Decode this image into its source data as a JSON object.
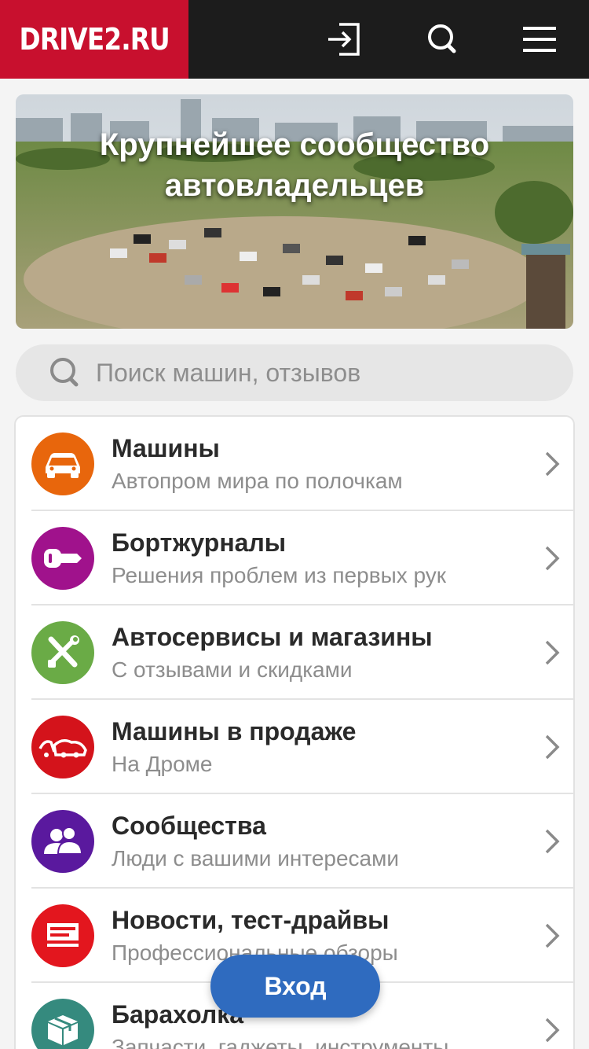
{
  "header": {
    "logo_text": "DRIVE2.RU",
    "icons": [
      "login-icon",
      "search-icon",
      "menu-icon"
    ],
    "colors": {
      "logo_bg": "#c8102e",
      "bar_bg": "#1c1c1c"
    }
  },
  "hero": {
    "title": "Крупнейшее сообщество автовладельцев"
  },
  "search": {
    "placeholder": "Поиск машин, отзывов"
  },
  "menu": {
    "items": [
      {
        "title": "Машины",
        "subtitle": "Автопром мира по полочкам",
        "icon": "car-icon",
        "color": "#e8660c"
      },
      {
        "title": "Бортжурналы",
        "subtitle": "Решения проблем из первых рук",
        "icon": "key-icon",
        "color": "#a0128c"
      },
      {
        "title": "Автосервисы и магазины",
        "subtitle": "С отзывами и скидками",
        "icon": "tools-icon",
        "color": "#6aab46"
      },
      {
        "title": "Машины в продаже",
        "subtitle": "На Дроме",
        "icon": "sale-cars-icon",
        "color": "#d4131b"
      },
      {
        "title": "Сообщества",
        "subtitle": "Люди с вашими интересами",
        "icon": "people-icon",
        "color": "#5a199e"
      },
      {
        "title": "Новости, тест-драйвы",
        "subtitle": "Профессиональные обзоры",
        "icon": "news-icon",
        "color": "#e3161e"
      },
      {
        "title": "Барахолка",
        "subtitle": "Запчасти, гаджеты, инструменты",
        "icon": "box-icon",
        "color": "#358a7e"
      }
    ]
  },
  "login_button": {
    "label": "Вход",
    "color": "#2f6bbf"
  }
}
